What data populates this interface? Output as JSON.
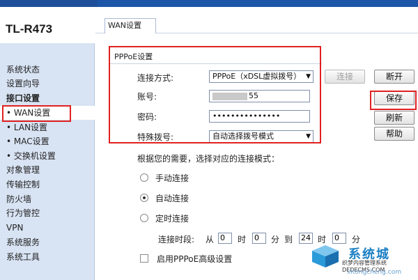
{
  "header": {
    "model": "TL-R473"
  },
  "sidebar": {
    "items": [
      {
        "label": "系统状态",
        "bold": false,
        "active": false
      },
      {
        "label": "设置向导",
        "bold": false,
        "active": false
      },
      {
        "label": "接口设置",
        "bold": true,
        "active": false
      },
      {
        "label": "• WAN设置",
        "bold": false,
        "active": true
      },
      {
        "label": "• LAN设置",
        "bold": false,
        "active": false
      },
      {
        "label": "• MAC设置",
        "bold": false,
        "active": false
      },
      {
        "label": "• 交换机设置",
        "bold": false,
        "active": false
      },
      {
        "label": "对象管理",
        "bold": false,
        "active": false
      },
      {
        "label": "传输控制",
        "bold": false,
        "active": false
      },
      {
        "label": "防火墙",
        "bold": false,
        "active": false
      },
      {
        "label": "行为管控",
        "bold": false,
        "active": false
      },
      {
        "label": "VPN",
        "bold": false,
        "active": false
      },
      {
        "label": "系统服务",
        "bold": false,
        "active": false
      },
      {
        "label": "系统工具",
        "bold": false,
        "active": false
      }
    ]
  },
  "tabs": [
    {
      "label": "WAN设置"
    }
  ],
  "pppoe": {
    "group_title": "PPPoE设置",
    "connection_type_label": "连接方式:",
    "connection_type_value": "PPPoE（xDSL虚拟拨号）",
    "account_label": "账号:",
    "account_value_suffix": "55",
    "password_label": "密码:",
    "password_value": "•••••••••••••••",
    "special_dial_label": "特殊拨号:",
    "special_dial_value": "自动选择拨号模式"
  },
  "buttons": {
    "connect": "连接",
    "disconnect": "断开",
    "save": "保存",
    "refresh": "刷新",
    "help": "帮助"
  },
  "mode": {
    "hint": "根据您的需要，选择对应的连接模式：",
    "options": [
      {
        "label": "手动连接",
        "selected": false
      },
      {
        "label": "自动连接",
        "selected": true
      },
      {
        "label": "定时连接",
        "selected": false
      }
    ],
    "time_label": "连接时段:",
    "from_label": "从",
    "from_hour": "0",
    "hour_label": "时",
    "from_min": "0",
    "min_label": "分",
    "to_label": "到",
    "to_hour": "24",
    "hour_label2": "时",
    "to_min": "0",
    "min_label2": "分"
  },
  "advanced": {
    "label": "启用PPPoE高级设置"
  },
  "watermark": {
    "title": "系统城",
    "sub": "织梦内容管理系统",
    "sub_domain": "DEDECMS.COM",
    "sub2": "xitongcheng.com"
  }
}
